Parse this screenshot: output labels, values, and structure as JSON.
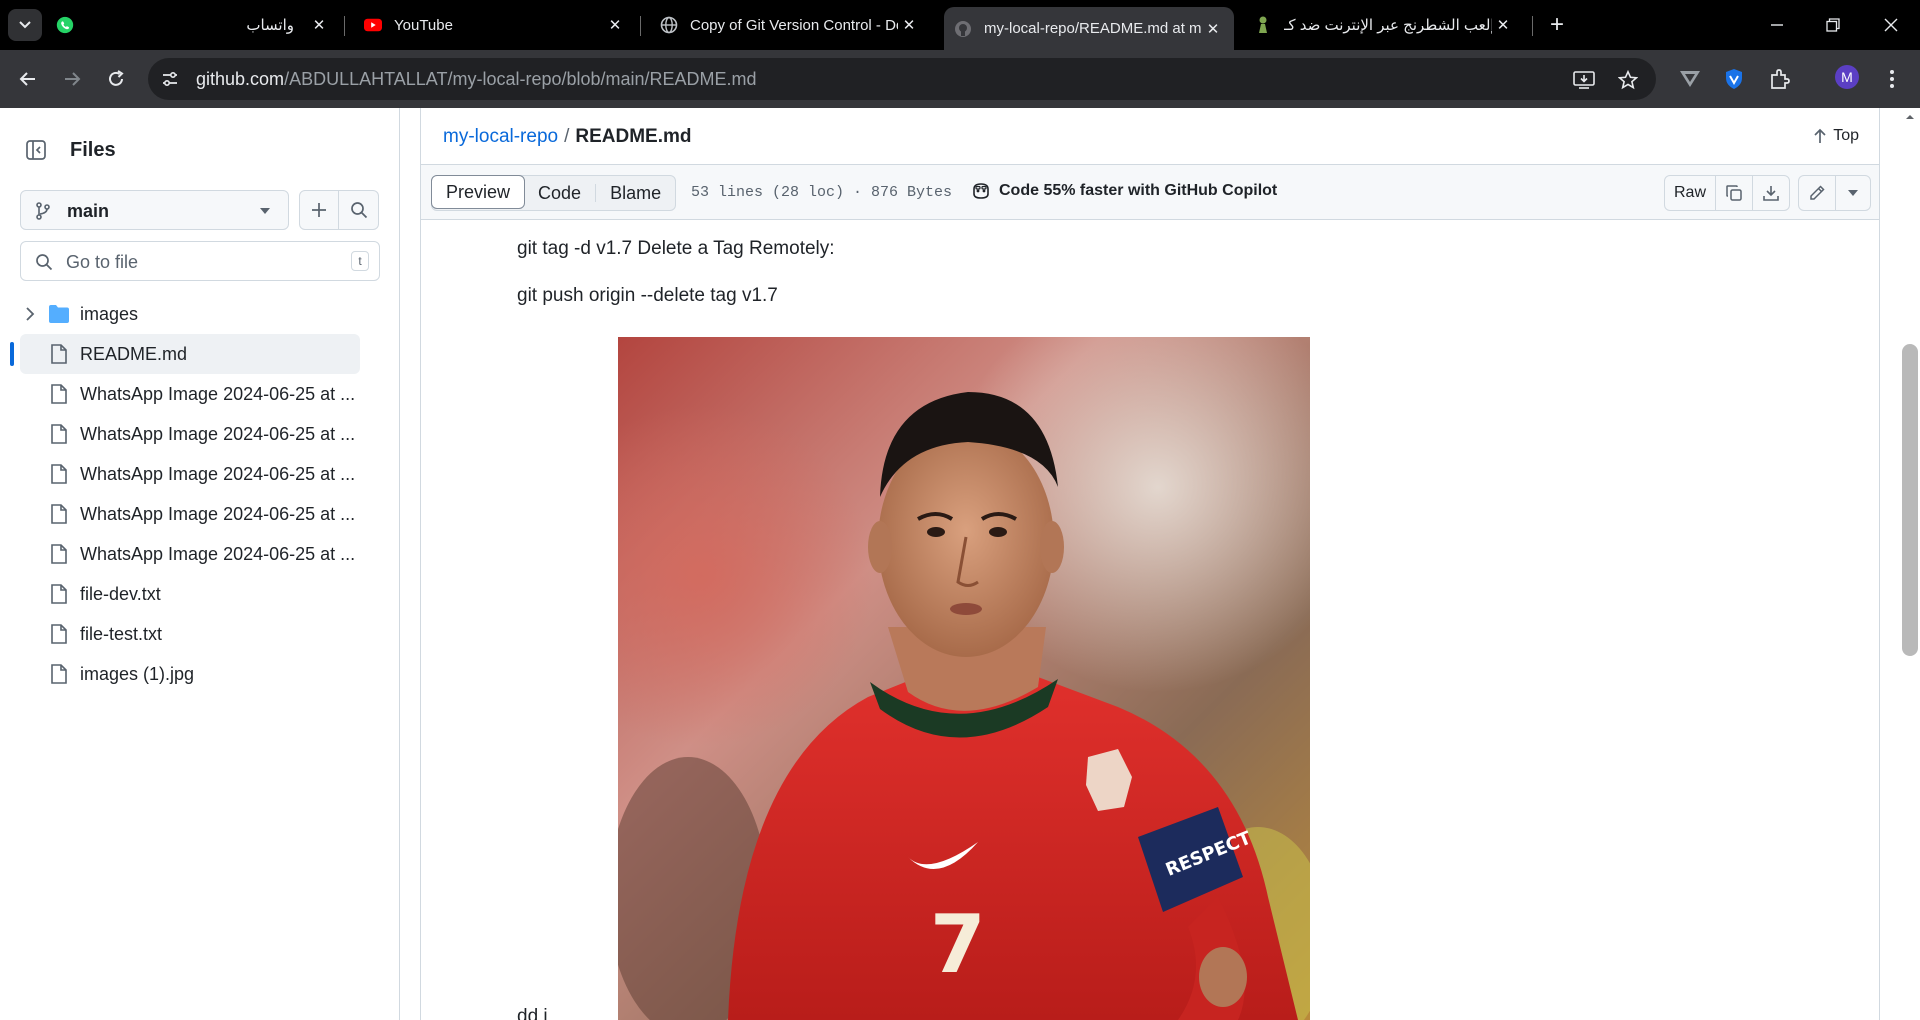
{
  "browser": {
    "tabs": [
      {
        "title": "واتساب",
        "icon": "whatsapp-icon"
      },
      {
        "title": "YouTube",
        "icon": "youtube-icon"
      },
      {
        "title": "Copy of Git Version Control - Do",
        "icon": "globe-icon"
      },
      {
        "title": "my-local-repo/README.md at m",
        "icon": "github-icon"
      },
      {
        "title": "إلعب الشطرنج عبر الإنترنت ضد كـ",
        "icon": "chess-pawn-icon"
      }
    ],
    "url_host": "github.com",
    "url_path": "/ABDULLAHTALLAT/my-local-repo/blob/main/README.md",
    "profile_initial": "M",
    "colors": {
      "chrome": "#000000",
      "toolbar": "#35363a",
      "omnibox": "#202124"
    }
  },
  "sidebar": {
    "title": "Files",
    "branch": "main",
    "search_placeholder": "Go to file",
    "shortcut": "t",
    "items": [
      {
        "label": "images",
        "type": "folder"
      },
      {
        "label": "README.md",
        "type": "file",
        "selected": true
      },
      {
        "label": "WhatsApp Image 2024-06-25 at ...",
        "type": "file"
      },
      {
        "label": "WhatsApp Image 2024-06-25 at ...",
        "type": "file"
      },
      {
        "label": "WhatsApp Image 2024-06-25 at ...",
        "type": "file"
      },
      {
        "label": "WhatsApp Image 2024-06-25 at ...",
        "type": "file"
      },
      {
        "label": "WhatsApp Image 2024-06-25 at ...",
        "type": "file"
      },
      {
        "label": "file-dev.txt",
        "type": "file"
      },
      {
        "label": "file-test.txt",
        "type": "file"
      },
      {
        "label": "images (1).jpg",
        "type": "file"
      }
    ]
  },
  "file": {
    "repo": "my-local-repo",
    "name": "README.md",
    "top_label": "Top",
    "tabs": [
      "Preview",
      "Code",
      "Blame"
    ],
    "meta": "53 lines (28 loc) · 876 Bytes",
    "copilot": "Code 55% faster with GitHub Copilot",
    "raw_label": "Raw"
  },
  "content": {
    "lines": [
      "git tag -d v1.7 Delete a Tag Remotely:",
      "git push origin --delete tag v1.7"
    ],
    "image": {
      "subject": "footballer portrait",
      "shirt_number": "7",
      "armband": "RESPECT"
    },
    "tail": "dd i"
  },
  "colors": {
    "link": "#0969da",
    "accent": "#0969da",
    "border": "#d1d9e0"
  }
}
